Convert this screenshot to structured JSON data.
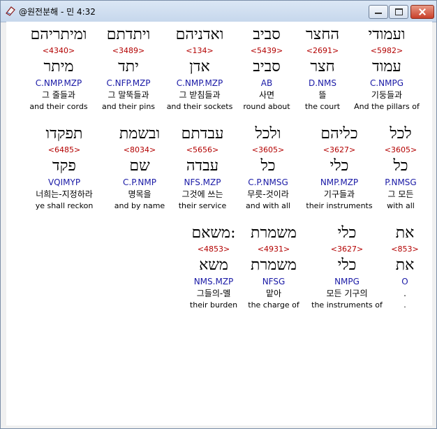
{
  "window": {
    "title": "@원전분해 - 민 4:32",
    "app_icon": "bible-book-icon",
    "buttons": [
      "minimize",
      "maximize",
      "close"
    ]
  },
  "rows": [
    {
      "cells": [
        {
          "heb": "ועמודי",
          "strong": "<5982>",
          "root": "עמוד",
          "parse": "C.NMPG",
          "kor": "기둥들과",
          "eng": "And the pillars of"
        },
        {
          "heb": "החצר",
          "strong": "<2691>",
          "root": "חצר",
          "parse": "D.NMS",
          "kor": "뜰",
          "eng": "the court"
        },
        {
          "heb": "סביב",
          "strong": "<5439>",
          "root": "סביב",
          "parse": "AB",
          "kor": "사면",
          "eng": "round about"
        },
        {
          "heb": "ואדניהם",
          "strong": "<134>",
          "root": "אדן",
          "parse": "C.NMP.MZP",
          "kor": "그 받침들과",
          "eng": "and their sockets"
        },
        {
          "heb": "ויתדתם",
          "strong": "<3489>",
          "root": "יתד",
          "parse": "C.NFP.MZP",
          "kor": "그 말뚝들과",
          "eng": "and their pins"
        },
        {
          "heb": "ומיתריהם",
          "strong": "<4340>",
          "root": "מיתר",
          "parse": "C.NMP.MZP",
          "kor": "그 줄들과",
          "eng": "and their cords"
        }
      ]
    },
    {
      "cells": [
        {
          "heb": "לכל",
          "strong": "<3605>",
          "root": "כל",
          "parse": "P.NMSG",
          "kor": "그 모든",
          "eng": "with all"
        },
        {
          "heb": "כליהם",
          "strong": "<3627>",
          "root": "כלי",
          "parse": "NMP.MZP",
          "kor": "기구들과",
          "eng": "their instruments"
        },
        {
          "heb": "ולכל",
          "strong": "<3605>",
          "root": "כל",
          "parse": "C.P.NMSG",
          "kor": "무릇-것이라",
          "eng": "and with all"
        },
        {
          "heb": "עבדתם",
          "strong": "<5656>",
          "root": "עבדה",
          "parse": "NFS.MZP",
          "kor": "그것에 쓰는",
          "eng": "their service"
        },
        {
          "heb": "ובשמת",
          "strong": "<8034>",
          "root": "שם",
          "parse": "C.P.NMP",
          "kor": "명목을",
          "eng": "and by name"
        },
        {
          "heb": "תפקדו",
          "strong": "<6485>",
          "root": "פקד",
          "parse": "VQIMYP",
          "kor": "너희는-지정하라",
          "eng": "ye shall reckon"
        }
      ]
    },
    {
      "cells": [
        {
          "heb": "את",
          "strong": "<853>",
          "root": "את",
          "parse": "O",
          "kor": ".",
          "eng": "."
        },
        {
          "heb": "כלי",
          "strong": "<3627>",
          "root": "כלי",
          "parse": "NMPG",
          "kor": "모든 기구의",
          "eng": "the instruments of"
        },
        {
          "heb": "משמרת",
          "strong": "<4931>",
          "root": "משמרת",
          "parse": "NFSG",
          "kor": "맡아",
          "eng": "the charge of"
        },
        {
          "heb": "משאם:",
          "strong": "<4853>",
          "root": "משא",
          "parse": "NMS.MZP",
          "kor": "그들의-멜",
          "eng": "their burden"
        }
      ]
    }
  ]
}
